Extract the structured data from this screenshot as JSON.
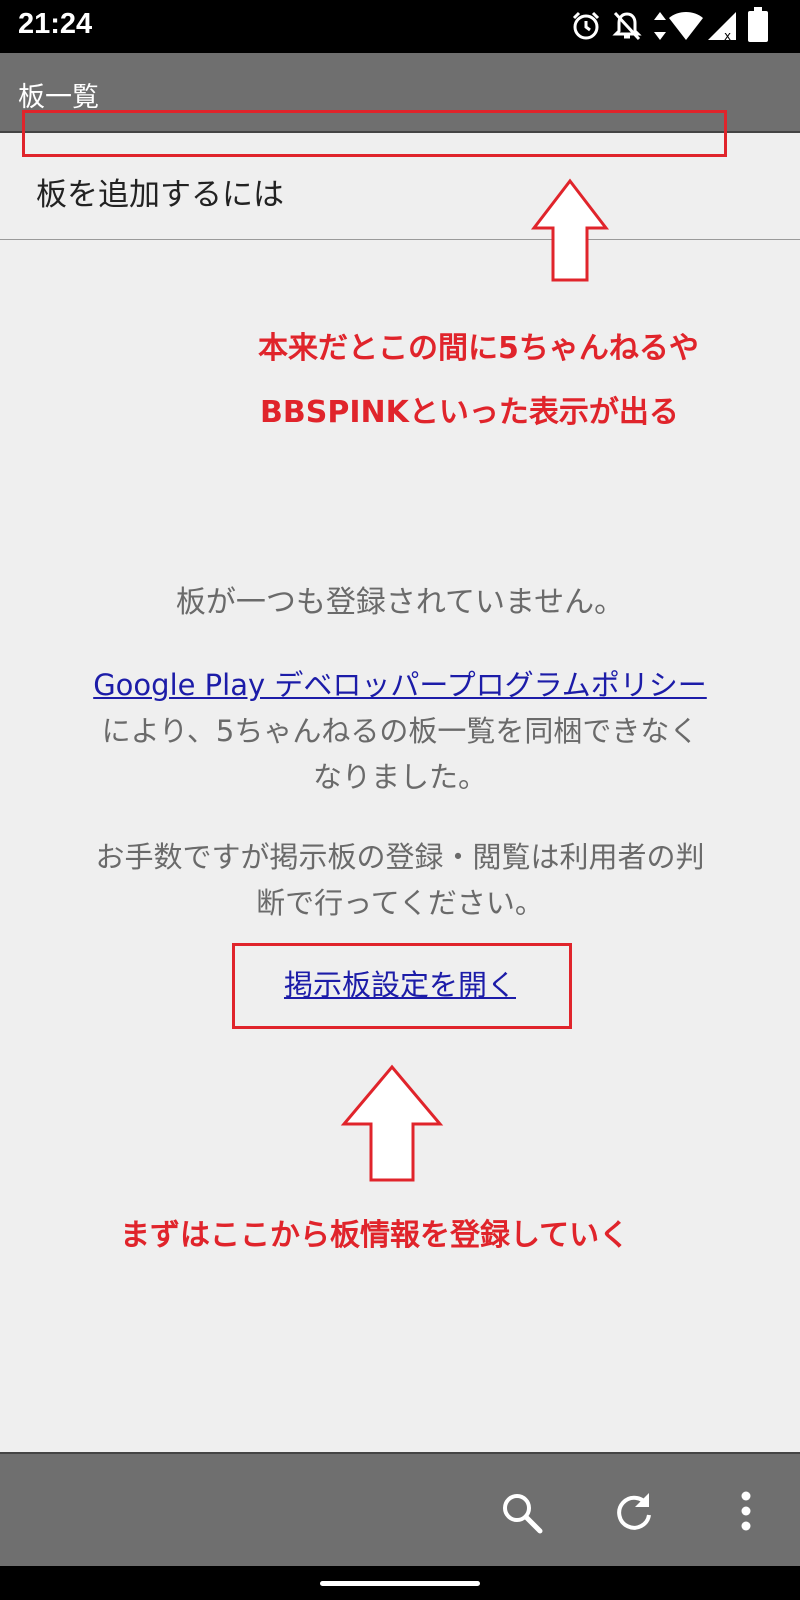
{
  "status_bar": {
    "time": "21:24",
    "icons": [
      "alarm-icon",
      "notifications-off-icon",
      "data-arrows-icon",
      "wifi-icon",
      "cell-signal-icon",
      "battery-icon"
    ]
  },
  "app_bar": {
    "title": "板一覧"
  },
  "list": {
    "add_board_label": "板を追加するには"
  },
  "annotations": {
    "top_note_line1": "本来だとこの間に5ちゃんねるや",
    "top_note_line2": "BBSPINKといった表示が出る",
    "bottom_note": "まずはここから板情報を登録していく",
    "color": "#e0242b"
  },
  "empty_state": {
    "heading": "板が一つも登録されていません。",
    "policy_link": "Google Play デベロッパープログラムポリシー",
    "policy_text_1": "により、5ちゃんねるの板一覧を同梱できなく",
    "policy_text_2": "なりました。",
    "notice_1": "お手数ですが掲示板の登録・閲覧は利用者の判",
    "notice_2": "断で行ってください。",
    "open_settings_link": "掲示板設定を開く"
  },
  "bottom_bar": {
    "icons": [
      "search-icon",
      "refresh-icon",
      "more-vert-icon"
    ]
  }
}
